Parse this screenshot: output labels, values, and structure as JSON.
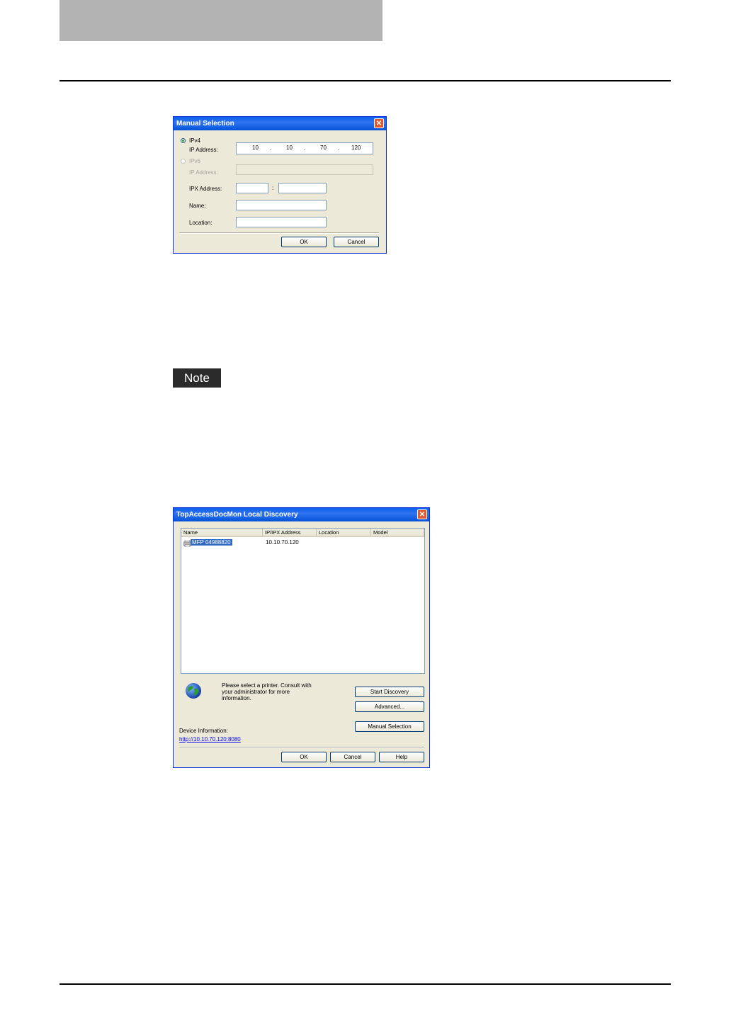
{
  "dialog1": {
    "title": "Manual Selection",
    "ipv4_label": "IPv4",
    "ipv4_address_label": "IP Address:",
    "ipv4_octets": [
      "10",
      "10",
      "70",
      "120"
    ],
    "ipv6_label": "IPv6",
    "ipv6_address_label": "IP Address:",
    "ipx_address_label": "IPX Address:",
    "ipx_separator": ":",
    "name_label": "Name:",
    "location_label": "Location:",
    "ok_label": "OK",
    "cancel_label": "Cancel",
    "close_glyph": "✕"
  },
  "note": {
    "label": "Note"
  },
  "dialog2": {
    "title": "TopAccessDocMon Local Discovery",
    "columns": [
      "Name",
      "IP/IPX Address",
      "Location",
      "Model"
    ],
    "rows": [
      {
        "name": "MFP 04988820",
        "address": "10.10.70.120",
        "location": "",
        "model": ""
      }
    ],
    "message": "Please select a printer. Consult with your administrator for more information.",
    "start_discovery_label": "Start Discovery",
    "advanced_label": "Advanced...",
    "manual_selection_label": "Manual Selection",
    "device_info_label": "Device Information:",
    "device_url": "http://10.10.70.120:8080",
    "ok_label": "OK",
    "cancel_label": "Cancel",
    "help_label": "Help",
    "close_glyph": "✕"
  },
  "icons": {
    "radio": "radio-icon",
    "printer": "printer-icon",
    "globe": "globe-icon",
    "close": "close-icon"
  }
}
